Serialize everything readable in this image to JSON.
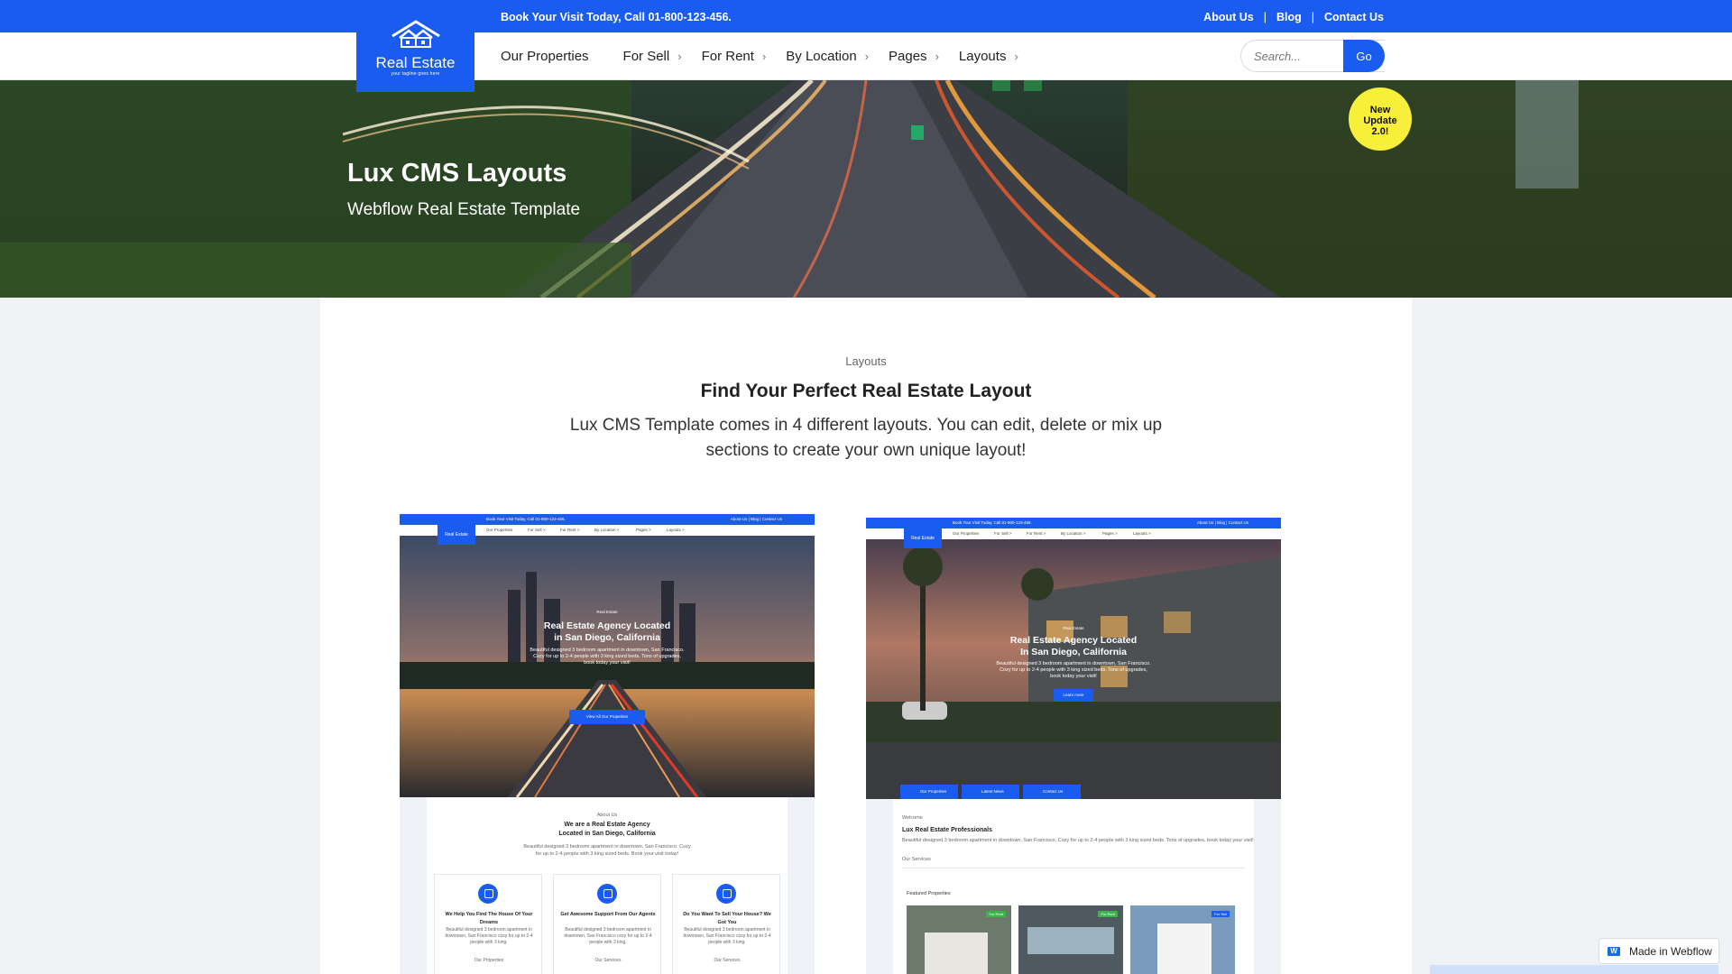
{
  "topbar": {
    "call_text": "Book Your Visit Today, Call 01-800-123-456.",
    "links": [
      "About Us",
      "Blog",
      "Contact Us"
    ],
    "separator": "|"
  },
  "logo": {
    "name": "Real Estate",
    "tagline": "your tagline goes here"
  },
  "nav": {
    "items": [
      {
        "label": "Our Properties",
        "has_chevron": false
      },
      {
        "label": "For Sell",
        "has_chevron": true
      },
      {
        "label": "For Rent",
        "has_chevron": true
      },
      {
        "label": "By Location",
        "has_chevron": true
      },
      {
        "label": "Pages",
        "has_chevron": true
      },
      {
        "label": "Layouts",
        "has_chevron": true
      }
    ],
    "chevron_glyph": "›",
    "search_placeholder": "Search...",
    "search_button": "Go"
  },
  "hero": {
    "title": "Lux CMS Layouts",
    "subtitle": "Webflow Real Estate Template",
    "badge": [
      "New",
      "Update",
      "2.0!"
    ]
  },
  "section": {
    "eyebrow": "Layouts",
    "title": "Find Your Perfect Real Estate Layout",
    "description": "Lux CMS Template comes in 4 different layouts. You can edit, delete or mix up sections to create your own unique layout!"
  },
  "layout_1": {
    "top_call": "Book Your Visit Today, Call 01-800-123-456.",
    "top_links": "About Us | Blog | Contact Us",
    "nav": [
      "Our Properties",
      "For Sell >",
      "For Rent >",
      "By Location >",
      "Pages >",
      "Layouts >"
    ],
    "logo": "Real Estate",
    "hero_eyebrow": "Real Estate",
    "hero_title_1": "Real Estate Agency Located",
    "hero_title_2": "in San Diego, California",
    "hero_text_1": "Beautiful designed 3 bedroom apartment in downtown, San Francisco.",
    "hero_text_2": "Cozy for up to 2-4 people with 3 king sized beds. Tons of upgrades,",
    "hero_text_3": "book today your visit!",
    "button": "View All Our Properties",
    "about_eyebrow": "About Us",
    "about_title_1": "We are a Real Estate Agency",
    "about_title_2": "Located in San Diego, California",
    "about_text_1": "Beautiful designed 3 bedroom apartment in downtown, San Francisco. Cozy",
    "about_text_2": "for up to 2-4 people with 3 king sized beds. Book your visit today!",
    "features": [
      {
        "title": "We Help You Find The House Of Your Dreams",
        "text": "Beautiful designed 3 bedroom apartment in downtown, San Francisco cozy for up to 2-4 people with 3 king.",
        "link": "Our Properties"
      },
      {
        "title": "Get Awesome Support From Our Agents",
        "text": "Beautiful designed 3 bedroom apartment in downtown, San Francisco cozy for up to 2-4 people with 3 king.",
        "link": "Our Services"
      },
      {
        "title": "Do You Want To Sell Your House? We Got You",
        "text": "Beautiful designed 3 bedroom apartment in downtown, San Francisco cozy for up to 2-4 people with 3 king.",
        "link": "Our Services"
      }
    ]
  },
  "layout_2": {
    "top_call": "Book Your Visit Today, Call 01-800-123-456.",
    "top_links": "About Us | Blog | Contact Us",
    "nav": [
      "Our Properties",
      "For Sell >",
      "For Rent >",
      "By Location >",
      "Pages >",
      "Layouts >"
    ],
    "logo": "Real Estate",
    "hero_eyebrow": "Real Estate",
    "hero_title_1": "Real Estate Agency Located",
    "hero_title_2": "In San Diego, California",
    "hero_text_1": "Beautiful designed 3 bedroom apartment in downtown, San Francisco.",
    "hero_text_2": "Cozy for up to 2-4 people with 3 king sized beds. Tons of upgrades,",
    "hero_text_3": "book today your visit!",
    "button": "Learn more",
    "tabs": [
      "Our Properties",
      "Latest News",
      "Contact Us"
    ],
    "welcome_eyebrow": "Welcome",
    "welcome_title": "Lux Real Estate Professionals",
    "welcome_text": "Beautiful designed 3 bedroom apartment in downtown, San Francisco. Cozy for up to 2-4 people with 3 king sized beds. Tons of upgrades, book today your visit!",
    "welcome_link": "Our Services",
    "featured_title": "Featured Properties",
    "thumbs": [
      {
        "tag": "For Rent",
        "tag_color": "#3cb44b"
      },
      {
        "tag": "For Rent",
        "tag_color": "#3cb44b"
      },
      {
        "tag": "For Sell",
        "tag_color": "#1a5cf0"
      }
    ]
  },
  "webflow_badge": "Made in Webflow",
  "colors": {
    "primary": "#1a5cf0",
    "badge_yellow": "#f7ef3a",
    "tag_green": "#3cb44b"
  }
}
